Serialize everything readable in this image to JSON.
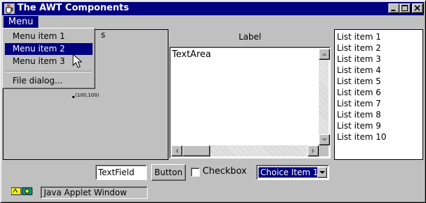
{
  "window": {
    "title": "The AWT Components",
    "minimize_label": "minimize",
    "maximize_label": "maximize",
    "close_label": "close"
  },
  "menubar": {
    "menu_title": "Menu"
  },
  "menu": {
    "items": [
      {
        "label": "Menu item 1",
        "selected": false
      },
      {
        "label": "Menu item 2",
        "selected": true
      },
      {
        "label": "Menu item 3",
        "selected": false
      },
      {
        "label": "File dialog...",
        "selected": false
      }
    ]
  },
  "canvas": {
    "clipped_text": "s",
    "coord_label": "(100,100)"
  },
  "label": {
    "text": "Label"
  },
  "textarea": {
    "value": "TextArea"
  },
  "list": {
    "items": [
      "List item 1",
      "List item 2",
      "List item 3",
      "List item 4",
      "List item 5",
      "List item 6",
      "List item 7",
      "List item 8",
      "List item 9",
      "List item 10"
    ]
  },
  "controls": {
    "textfield_value": "TextField",
    "button_label": "Button",
    "checkbox_label": "Checkbox",
    "checkbox_checked": false,
    "choice_selected": "Choice Item 1"
  },
  "statusbar": {
    "text": "Java Applet Window",
    "icon": "java-applet-icon"
  },
  "colors": {
    "titlebar": "#000080",
    "face": "#c0c0c0",
    "selection": "#000080"
  }
}
